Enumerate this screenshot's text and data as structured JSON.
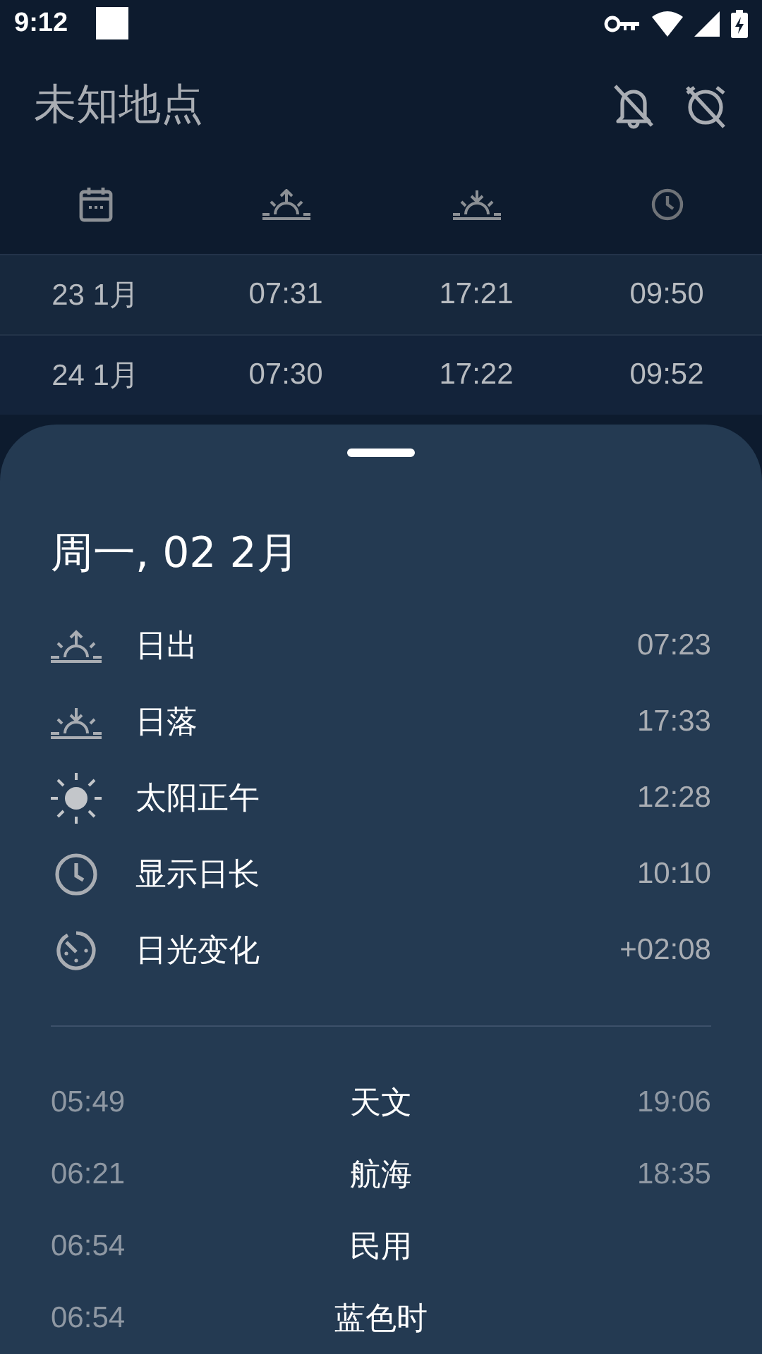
{
  "status_bar": {
    "time": "9:12"
  },
  "header": {
    "title": "未知地点"
  },
  "columns": [
    {
      "kind": "date"
    },
    {
      "kind": "sunrise"
    },
    {
      "kind": "sunset"
    },
    {
      "kind": "length"
    }
  ],
  "table": {
    "rows": [
      {
        "date": "23 1月",
        "sunrise": "07:31",
        "sunset": "17:21",
        "length": "09:50"
      },
      {
        "date": "24 1月",
        "sunrise": "07:30",
        "sunset": "17:22",
        "length": "09:52"
      }
    ]
  },
  "sheet": {
    "date": "周一, 02 2月",
    "details": [
      {
        "kind": "sunrise",
        "label": "日出",
        "value": "07:23"
      },
      {
        "kind": "sunset",
        "label": "日落",
        "value": "17:33"
      },
      {
        "kind": "noon",
        "label": "太阳正午",
        "value": "12:28"
      },
      {
        "kind": "length",
        "label": "显示日长",
        "value": "10:10"
      },
      {
        "kind": "change",
        "label": "日光变化",
        "value": "+02:08"
      }
    ],
    "twilight": [
      {
        "start": "05:49",
        "label": "天文",
        "end": "19:06"
      },
      {
        "start": "06:21",
        "label": "航海",
        "end": "18:35"
      },
      {
        "start": "06:54",
        "label": "民用"
      },
      {
        "start": "06:54",
        "label": "蓝色时"
      }
    ]
  }
}
